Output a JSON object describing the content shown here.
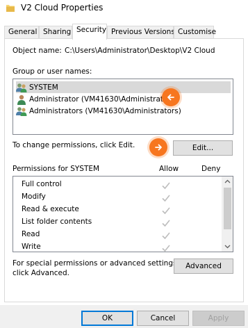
{
  "window": {
    "title": "V2 Cloud Properties"
  },
  "tabs": [
    {
      "label": "General"
    },
    {
      "label": "Sharing"
    },
    {
      "label": "Security"
    },
    {
      "label": "Previous Versions"
    },
    {
      "label": "Customise"
    }
  ],
  "security": {
    "object_name_label": "Object name:",
    "object_name_value": "C:\\Users\\Administrator\\Desktop\\V2 Cloud",
    "group_label": "Group or user names:",
    "users": [
      {
        "name": "SYSTEM"
      },
      {
        "name": "Administrator (VM41630\\Administrator)"
      },
      {
        "name": "Administrators (VM41630\\Administrators)"
      }
    ],
    "change_text": "To change permissions, click Edit.",
    "edit_label": "Edit...",
    "permissions_for": "Permissions for SYSTEM",
    "allow_header": "Allow",
    "deny_header": "Deny",
    "permissions": [
      {
        "name": "Full control",
        "allow": true,
        "deny": false
      },
      {
        "name": "Modify",
        "allow": true,
        "deny": false
      },
      {
        "name": "Read & execute",
        "allow": true,
        "deny": false
      },
      {
        "name": "List folder contents",
        "allow": true,
        "deny": false
      },
      {
        "name": "Read",
        "allow": true,
        "deny": false
      },
      {
        "name": "Write",
        "allow": true,
        "deny": false
      }
    ],
    "special_text_line1": "For special permissions or advanced settings,",
    "special_text_line2": "click Advanced.",
    "advanced_label": "Advanced"
  },
  "footer": {
    "ok_label": "OK",
    "cancel_label": "Cancel",
    "apply_label": "Apply"
  },
  "colors": {
    "accent": "#f7761f",
    "selection": "#d9d9d9",
    "check": "#bdbdbd"
  }
}
